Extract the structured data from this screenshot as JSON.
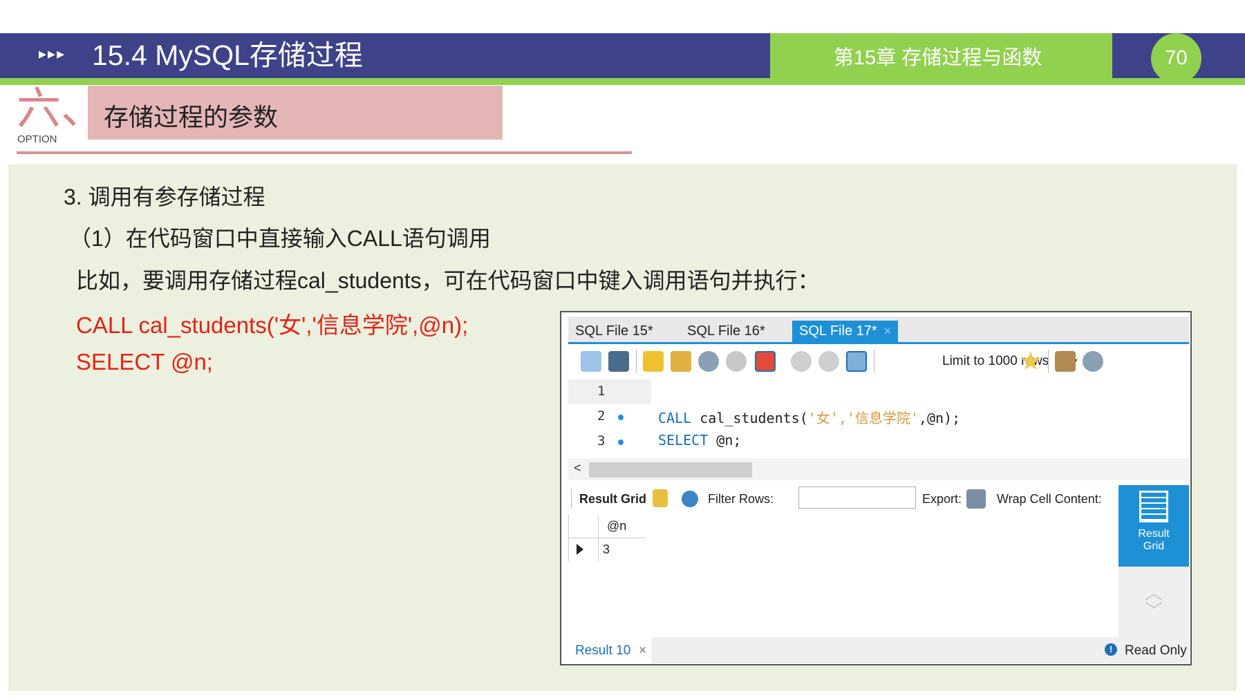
{
  "header": {
    "arrows": "▸▸▸",
    "title": "15.4 MySQL存储过程",
    "chapter": "第15章 存储过程与函数",
    "page_number": "70",
    "colors": {
      "navy": "#3d4289",
      "green": "#92d050",
      "pink": "#e4b6b6",
      "panel": "#ebf1de",
      "code_red": "#e32219"
    }
  },
  "section": {
    "number": "六、",
    "option_label": "OPTION",
    "title": "存储过程的参数"
  },
  "content": {
    "heading": "3. 调用有参存储过程",
    "subheading": "（1）在代码窗口中直接输入CALL语句调用",
    "description": "比如，要调用存储过程cal_students，可在代码窗口中键入调用语句并执行：",
    "code_line_1": "CALL cal_students('女','信息学院',@n);",
    "code_line_2": "SELECT @n;"
  },
  "workbench": {
    "tabs": [
      {
        "label": "SQL File 15*",
        "active": false
      },
      {
        "label": "SQL File 16*",
        "active": false
      },
      {
        "label": "SQL File 17*",
        "active": true
      }
    ],
    "tab_close": "×",
    "toolbar_icons": [
      "open-folder-icon",
      "save-icon",
      "execute-icon",
      "execute-current-icon",
      "explain-icon",
      "stop-icon",
      "toggle-error-icon",
      "commit-icon",
      "rollback-icon",
      "autocommit-icon",
      "bookmark-star-icon",
      "beautify-icon",
      "find-icon"
    ],
    "limit_select": "Limit to 1000 rows",
    "editor": {
      "line_numbers": [
        "1",
        "2",
        "3"
      ],
      "line2_kw": "CALL",
      "line2_mid": " cal_students(",
      "line2_str": "'女','信息学院'",
      "line2_end": ",@n);",
      "line3_kw": "SELECT",
      "line3_end": " @n;"
    },
    "scroll_left": "<",
    "result_toolbar": {
      "result_grid": "Result Grid",
      "filter_rows": "Filter Rows:",
      "export": "Export:",
      "wrap": "Wrap Cell Content:"
    },
    "side_button": {
      "line1": "Result",
      "line2": "Grid"
    },
    "grid": {
      "column": "@n",
      "value": "3"
    },
    "bottom": {
      "result_tab": "Result 10",
      "close": "×",
      "status": "Read Only"
    }
  }
}
